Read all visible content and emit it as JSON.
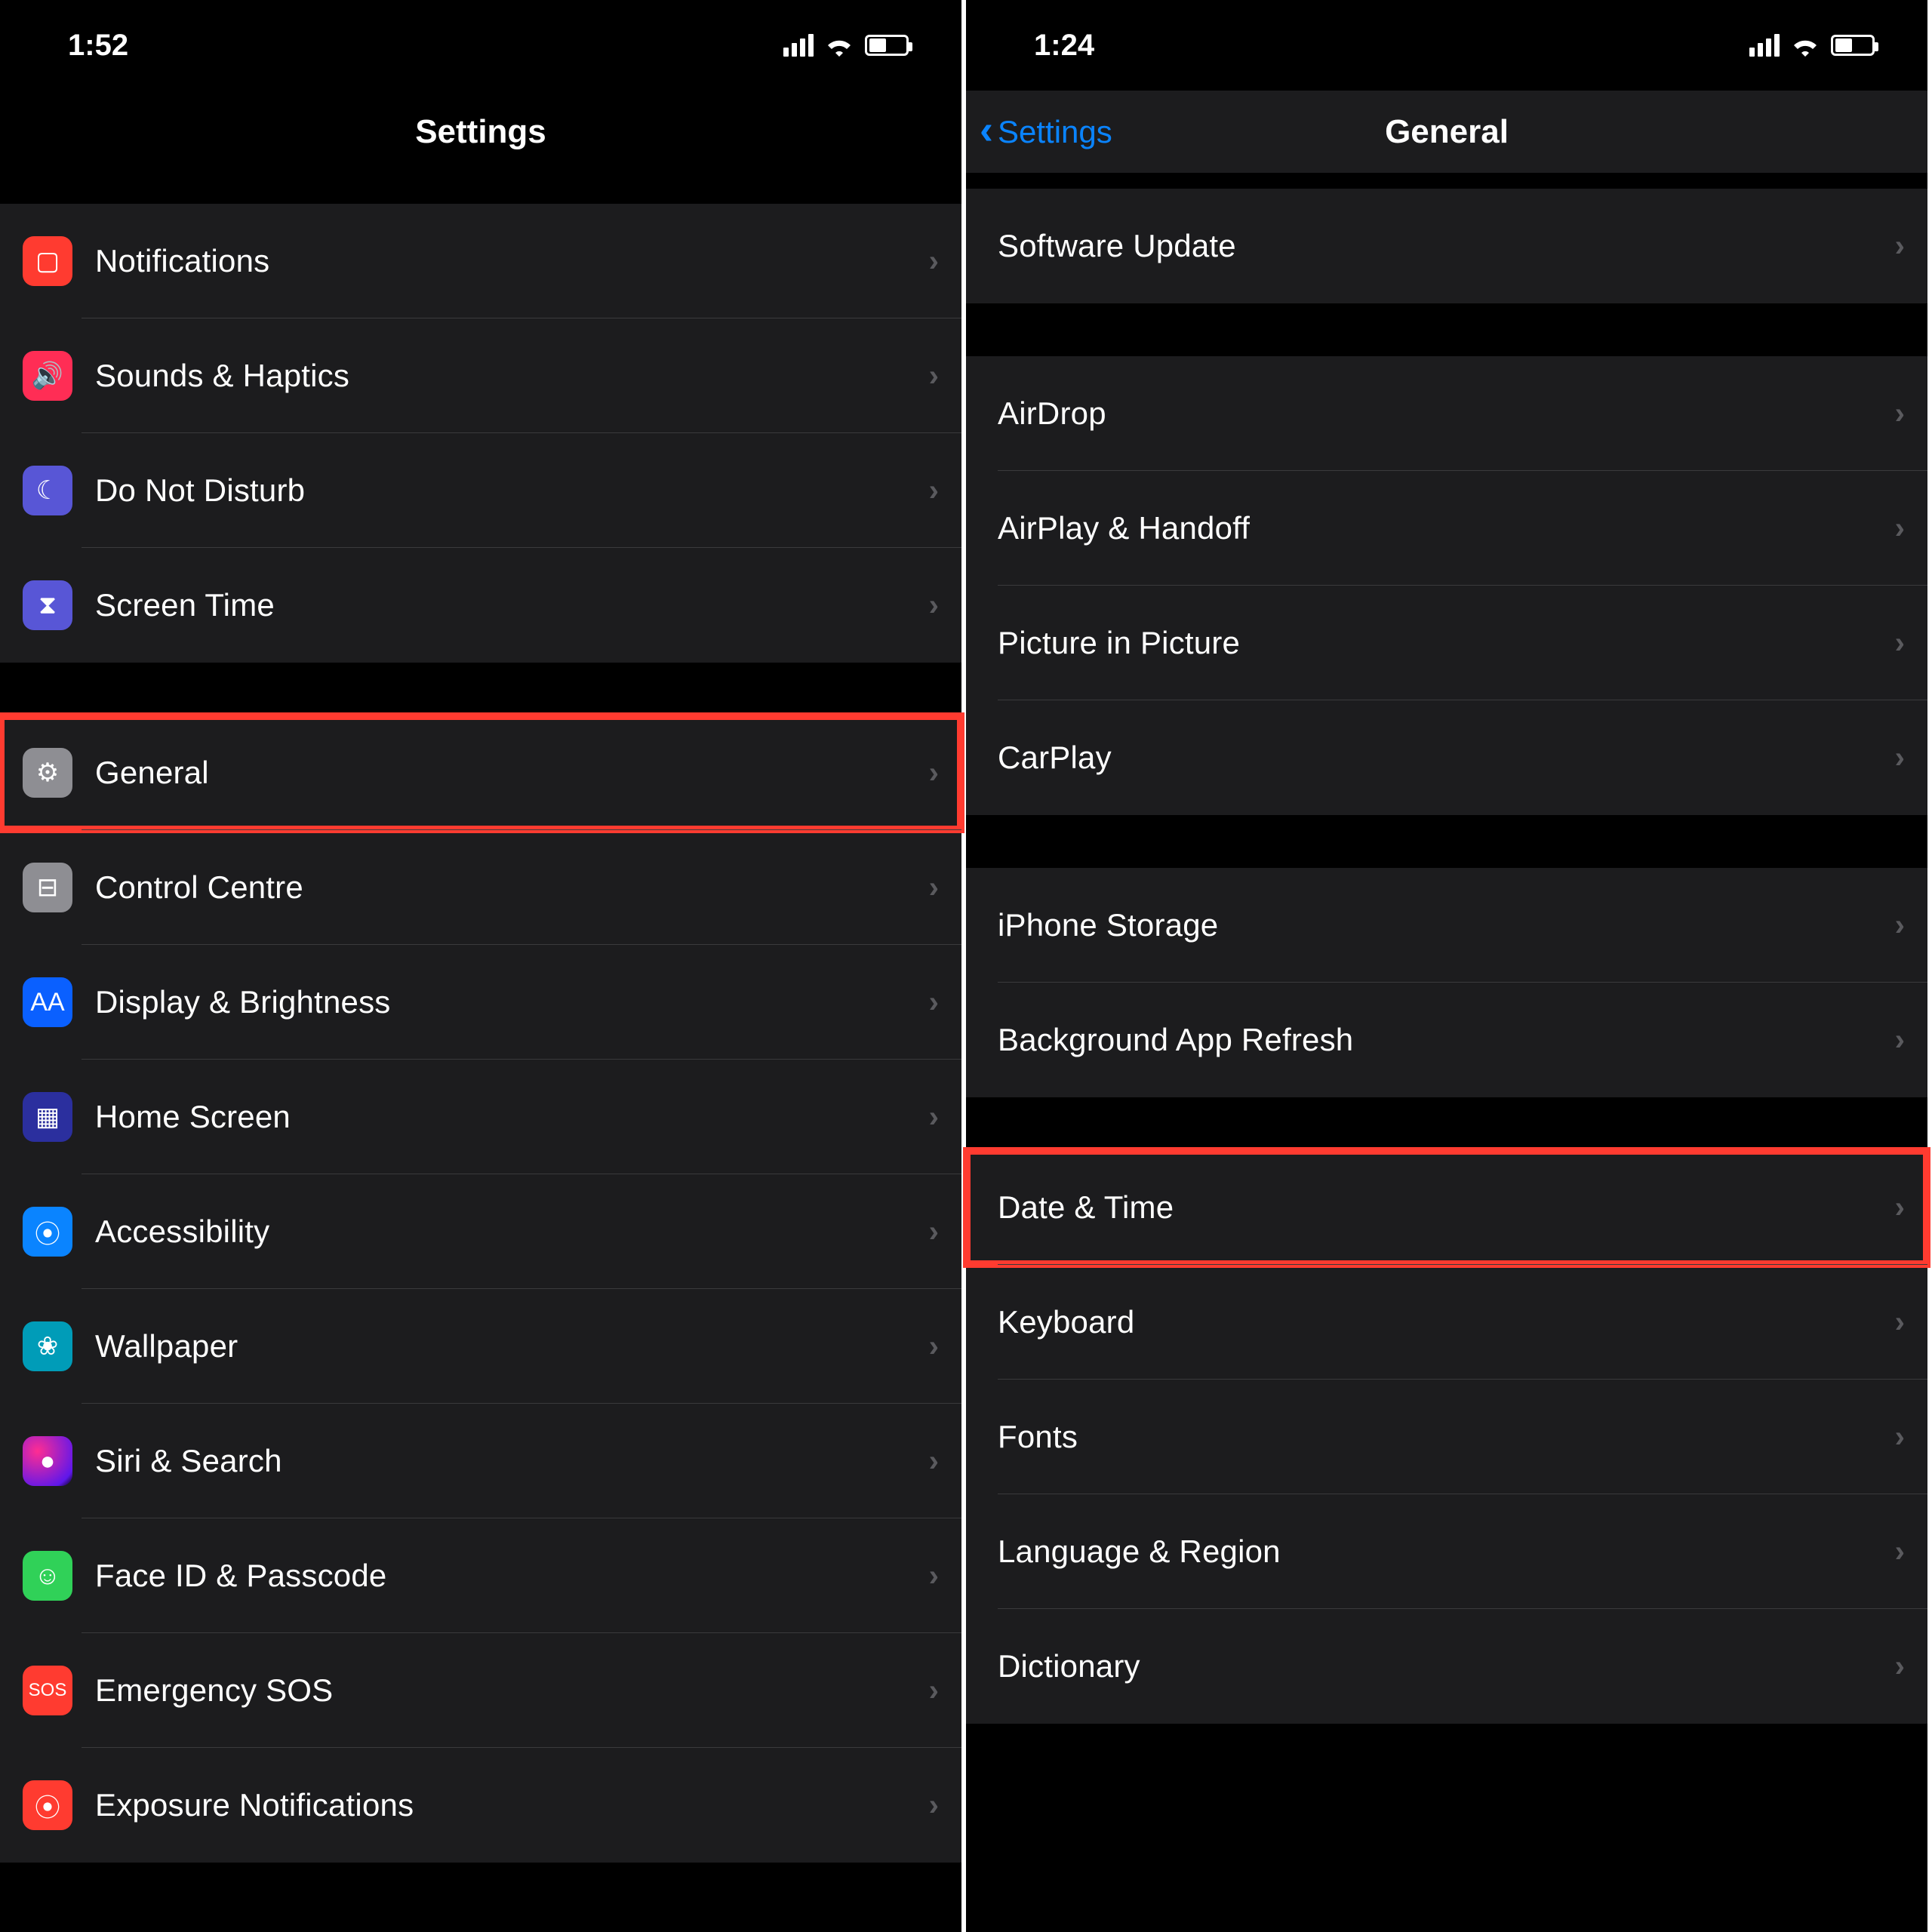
{
  "left": {
    "status": {
      "time": "1:52",
      "battery_pct": 45
    },
    "title": "Settings",
    "groups": [
      {
        "rows": [
          {
            "id": "notifications",
            "label": "Notifications",
            "icon": "notifications-icon",
            "glyph": "▢"
          },
          {
            "id": "sounds",
            "label": "Sounds & Haptics",
            "icon": "sounds-icon",
            "glyph": "🔊"
          },
          {
            "id": "dnd",
            "label": "Do Not Disturb",
            "icon": "dnd-icon",
            "glyph": "☾"
          },
          {
            "id": "screentime",
            "label": "Screen Time",
            "icon": "screentime-icon",
            "glyph": "⧗"
          }
        ]
      },
      {
        "rows": [
          {
            "id": "general",
            "label": "General",
            "icon": "general-icon",
            "glyph": "⚙",
            "highlight": true
          },
          {
            "id": "control",
            "label": "Control Centre",
            "icon": "control-icon",
            "glyph": "⊟"
          },
          {
            "id": "display",
            "label": "Display & Brightness",
            "icon": "display-icon",
            "glyph": "AA"
          },
          {
            "id": "home",
            "label": "Home Screen",
            "icon": "home-icon",
            "glyph": "▦"
          },
          {
            "id": "accessibility",
            "label": "Accessibility",
            "icon": "accessibility-icon",
            "glyph": "⦿"
          },
          {
            "id": "wallpaper",
            "label": "Wallpaper",
            "icon": "wallpaper-icon",
            "glyph": "❀"
          },
          {
            "id": "siri",
            "label": "Siri & Search",
            "icon": "siri-icon",
            "glyph": "●"
          },
          {
            "id": "faceid",
            "label": "Face ID & Passcode",
            "icon": "faceid-icon",
            "glyph": "☺"
          },
          {
            "id": "sos",
            "label": "Emergency SOS",
            "icon": "sos-icon",
            "glyph": "SOS"
          },
          {
            "id": "exposure",
            "label": "Exposure Notifications",
            "icon": "exposure-icon",
            "glyph": "⦿"
          }
        ]
      }
    ]
  },
  "right": {
    "status": {
      "time": "1:24",
      "battery_pct": 45
    },
    "back_label": "Settings",
    "title": "General",
    "groups": [
      {
        "rows": [
          {
            "id": "swupdate",
            "label": "Software Update"
          }
        ]
      },
      {
        "rows": [
          {
            "id": "airdrop",
            "label": "AirDrop"
          },
          {
            "id": "airplay",
            "label": "AirPlay & Handoff"
          },
          {
            "id": "pip",
            "label": "Picture in Picture"
          },
          {
            "id": "carplay",
            "label": "CarPlay"
          }
        ]
      },
      {
        "rows": [
          {
            "id": "storage",
            "label": "iPhone Storage"
          },
          {
            "id": "bgrefresh",
            "label": "Background App Refresh"
          }
        ]
      },
      {
        "rows": [
          {
            "id": "datetime",
            "label": "Date & Time",
            "highlight": true
          },
          {
            "id": "keyboard",
            "label": "Keyboard"
          },
          {
            "id": "fonts",
            "label": "Fonts"
          },
          {
            "id": "lang",
            "label": "Language & Region"
          },
          {
            "id": "dict",
            "label": "Dictionary"
          }
        ]
      }
    ]
  },
  "icon_classes": {
    "notifications-icon": "ic-notifications",
    "sounds-icon": "ic-sounds",
    "dnd-icon": "ic-dnd",
    "screentime-icon": "ic-screentime",
    "general-icon": "ic-general",
    "control-icon": "ic-control",
    "display-icon": "ic-display",
    "home-icon": "ic-home",
    "accessibility-icon": "ic-accessibility",
    "wallpaper-icon": "ic-wallpaper",
    "siri-icon": "ic-siri",
    "faceid-icon": "ic-faceid",
    "sos-icon": "ic-sos",
    "exposure-icon": "ic-exposure"
  }
}
